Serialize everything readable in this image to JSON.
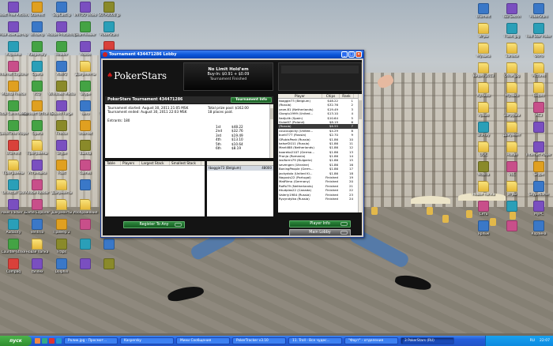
{
  "desktop": {
    "left_icons": [
      "Avast Free Antivirus",
      "Utorrent",
      "SopCast.ip",
      "ImTOO Video",
      "SOTA0000.jp",
      "Мой компьютер",
      "Winamp",
      "Adobe Photoshop",
      "TeamViewer",
      "PokerStars",
      "Корзина",
      "Kaspersky",
      "Reader",
      "Adobe",
      "Hold'em",
      "Internet Explorer",
      "Opera",
      "AIMP2",
      "Документы",
      "Fraps",
      "Mozilla Firefox",
      "ICQ",
      "Windows Media",
      "Skype",
      "uTorrent",
      "Total Commander",
      "Microsoft Office W...",
      "Sound Forge",
      "Nero",
      "Photoshop",
      "QuickTime Player",
      "Opera",
      "Firefox",
      "Internet",
      "Player",
      "uTorrent",
      "Программы",
      "Skype",
      "Выход",
      "",
      "Программы",
      "Установка",
      "Foxit",
      "Games",
      "",
      "Uninstall Tool",
      "Adobe Reader",
      "Документы",
      "",
      "",
      "PokerTracker 3",
      "Game Explorer",
      "Документы",
      "Изображения",
      "",
      "Audacity",
      "Ventrilo",
      "Пример 2",
      "",
      "",
      "Counter-Strike",
      "Новая папка",
      "Fraps",
      "",
      "",
      "Compaq",
      "Yandex",
      "Dolphin",
      "",
      ""
    ],
    "right_icons": [
      "uTorrent",
      "IE8 Беспл",
      "PokerStars",
      "Игры",
      "Flash.jpg",
      "Red Star Poker",
      "Музыка",
      "Записи",
      "Фото",
      "Видео 2013",
      "Обои.jpg",
      "Pictures",
      "Архивы",
      "Музыка",
      "Видео",
      "Архив",
      "Загрузки",
      "AC3",
      "Blu-ray",
      "Документ",
      "",
      "DOC",
      "Новая",
      "Internet Player",
      "Mozilla",
      "VLC",
      "Skype",
      "Новая папка",
      "Игры",
      "SkypeName",
      "Сеть",
      "",
      "MyPC",
      "Ярлык",
      "",
      "Корзина"
    ]
  },
  "window": {
    "title": "Tournament 434471286 Lobby",
    "brand": "PokerStars",
    "game": {
      "name": "No Limit Hold'em",
      "buyin": "Buy-In: $0.91 + $0.09",
      "status": "Tournament Finished"
    },
    "info_header": "PokerStars Tournament 434471286",
    "tournament_info_button": "Tournament Info",
    "info": {
      "started": "Tournament started:  August 30, 2011 21:05 MSK",
      "ended": "Tournament ended:  August 30, 2011 22:03 MSK",
      "entrants": "Entrants:  180",
      "prize_pool": "Total prize pool: $162.00",
      "places_paid": "18 places paid.",
      "prizes": [
        {
          "place": "1st",
          "amount": "$48.22"
        },
        {
          "place": "2nd",
          "amount": "$32.76"
        },
        {
          "place": "3rd",
          "amount": "$19.49"
        },
        {
          "place": "4th",
          "amount": "$13.10"
        },
        {
          "place": "5th",
          "amount": "$10.64"
        },
        {
          "place": "6th",
          "amount": "$8.19"
        }
      ]
    },
    "tables_columns": [
      "Table",
      "Players",
      "Largest Stack",
      "Smallest Stack"
    ],
    "seat": {
      "name": "tbaggie73 (Belgium)",
      "chips": "48000"
    },
    "register_button": "Register To Any",
    "player_info_button": "Player Info",
    "main_lobby_button": "Main Lobby",
    "players_columns": [
      "Player",
      "Chips",
      "Rank"
    ],
    "players": [
      {
        "name": "tbaggie73 (Belgium)",
        "chips": "$48.22",
        "rank": "1"
      },
      {
        "name": "(Russia)",
        "chips": "$32.76",
        "rank": "2"
      },
      {
        "name": "yeze-81 (Netherlands)",
        "chips": "$19.49",
        "rank": "3"
      },
      {
        "name": "Giorgiu1999 (United...",
        "chips": "$13.10",
        "rank": "4"
      },
      {
        "name": "liadjulik (Spain)",
        "chips": "$10.64",
        "rank": "5"
      },
      {
        "name": "Dube87 (Poland)",
        "chips": "$8.19",
        "rank": "6"
      },
      {
        "name": "(Russia)",
        "chips": "$6.55",
        "rank": "7"
      },
      {
        "name": "coucoujacky (United...",
        "chips": "$4.29",
        "rank": "8"
      },
      {
        "name": "bunti777 (Russia)",
        "chips": "$2.70",
        "rank": "9"
      },
      {
        "name": "GRubisPeak (Russia)",
        "chips": "$1.86",
        "rank": "10"
      },
      {
        "name": "katsef2011 (Russia)",
        "chips": "$1.86",
        "rank": "11"
      },
      {
        "name": "Mantil88 (Netherlands)",
        "chips": "$1.86",
        "rank": "12"
      },
      {
        "name": "booreko2107 (Germa...",
        "chips": "$1.86",
        "rank": "13"
      },
      {
        "name": "Pronjo (Romania)",
        "chips": "$1.86",
        "rank": "14"
      },
      {
        "name": "lasiformi79 (Bulgaria)",
        "chips": "$1.86",
        "rank": "15"
      },
      {
        "name": "sevengen (Ukraine)",
        "chips": "$1.86",
        "rank": "16"
      },
      {
        "name": "BoningPeople (Germ...",
        "chips": "$1.86",
        "rank": "17"
      },
      {
        "name": "jackydolo (United Ki...",
        "chips": "$1.86",
        "rank": "18"
      },
      {
        "name": "Nagusis22 (Portugal)",
        "chips": "Finished",
        "rank": "19"
      },
      {
        "name": "MatRimo (Germany)",
        "chips": "Finished",
        "rank": "20"
      },
      {
        "name": "Raffo79 (Netherlands)",
        "chips": "Finished",
        "rank": "21"
      },
      {
        "name": "ittudplas22 (Canada)",
        "chips": "Finished",
        "rank": "22"
      },
      {
        "name": "Valeriy1984 (Russia)",
        "chips": "Finished",
        "rank": "23"
      },
      {
        "name": "Ryzyndylka (Russia)",
        "chips": "Finished",
        "rank": "24"
      }
    ]
  },
  "taskbar": {
    "start_label": "пуск",
    "tasks": [
      {
        "label": "Ролик.jpg - Просмот...",
        "active": false
      },
      {
        "label": "Kaspersky",
        "active": false
      },
      {
        "label": "Мини Сообщения",
        "active": false
      },
      {
        "label": "PokerTracker v3.10",
        "active": false
      },
      {
        "label": "11. Troll - Все чудес...",
        "active": false
      },
      {
        "label": "\"Форт\" - отделения",
        "active": false
      },
      {
        "label": "3 PokerStars (RU)",
        "active": true
      }
    ],
    "lang": "RU",
    "clock": "22:07"
  }
}
